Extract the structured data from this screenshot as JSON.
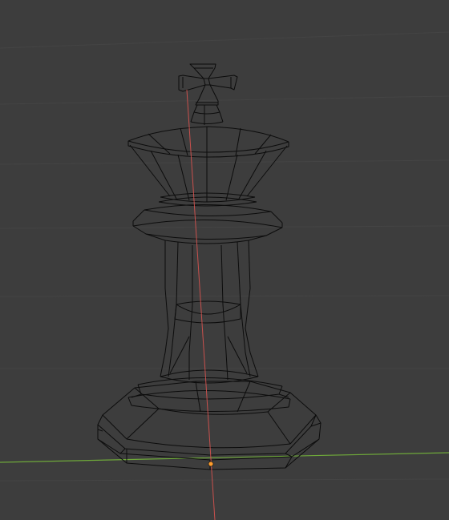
{
  "viewport": {
    "mode": "wireframe",
    "object": "chess-king",
    "background_color": "#3d3d3d",
    "grid_color": "#474747",
    "wire_color": "#0c0c0c",
    "x_axis_color": "#d9534f",
    "y_axis_color": "#6ea83a",
    "origin_color": "#ff9e2c"
  }
}
